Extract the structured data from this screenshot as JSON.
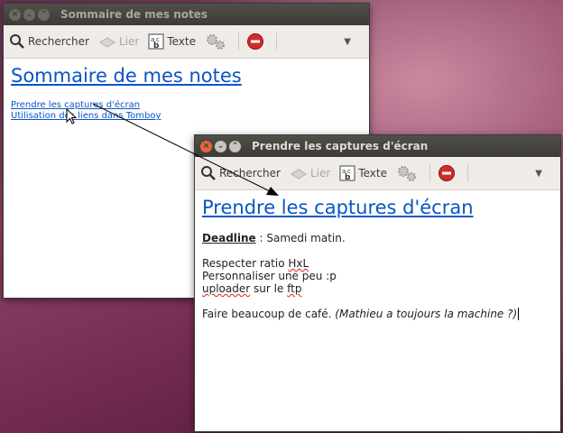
{
  "back_window": {
    "title": "Sommaire de mes notes",
    "toolbar": {
      "search": "Rechercher",
      "link": "Lier",
      "text": "Texte"
    },
    "note_title": "Sommaire de mes notes",
    "links": [
      "Prendre les captures d'écran",
      "Utilisation des liens dans Tomboy"
    ]
  },
  "front_window": {
    "title": "Prendre les captures d'écran",
    "toolbar": {
      "search": "Rechercher",
      "link": "Lier",
      "text": "Texte"
    },
    "note_title": "Prendre les captures d'écran",
    "deadline_label": "Deadline",
    "deadline_value": " : Samedi matin.",
    "line1_a": "Respecter ratio ",
    "line1_b": "HxL",
    "line2": "Personnaliser une peu :p",
    "line3_a": "uploader",
    "line3_b": " sur le ",
    "line3_c": "ftp",
    "line4_a": "Faire beaucoup de café. ",
    "line4_b": "(Mathieu a toujours la machine ?)"
  },
  "colors": {
    "link": "#0a55c2",
    "close_button": "#e8653a",
    "titlebar": "#3c3b37"
  }
}
